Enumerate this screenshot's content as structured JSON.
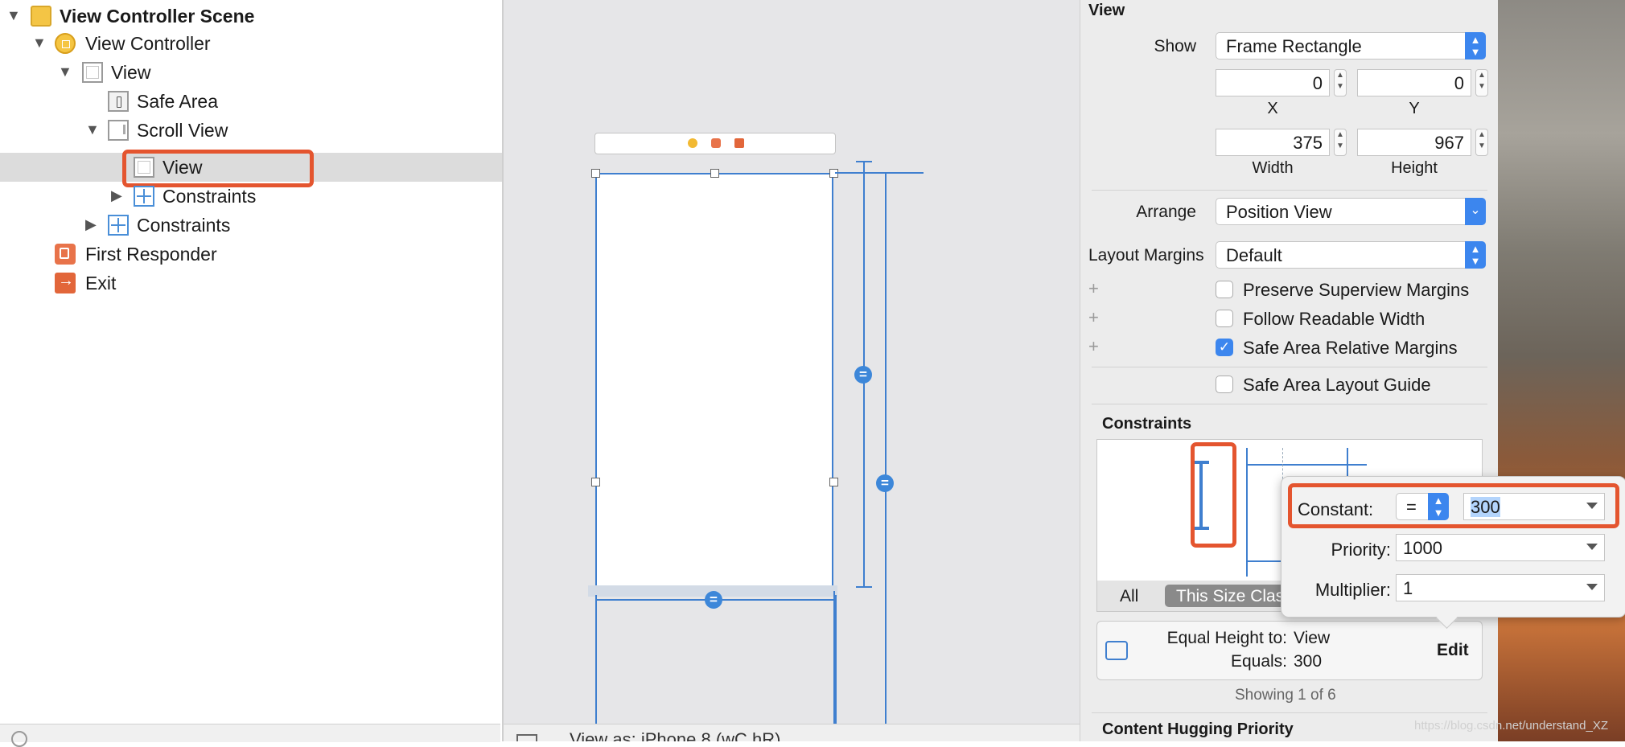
{
  "navigator": {
    "items": [
      {
        "label": "View Controller Scene",
        "icon": "storyboard-scene-icon"
      },
      {
        "label": "View Controller",
        "icon": "view-controller-icon"
      },
      {
        "label": "View",
        "icon": "view-icon"
      },
      {
        "label": "Safe Area",
        "icon": "safe-area-icon"
      },
      {
        "label": "Scroll View",
        "icon": "scroll-view-icon"
      },
      {
        "label": "View",
        "icon": "view-icon"
      },
      {
        "label": "Constraints",
        "icon": "constraints-icon"
      },
      {
        "label": "Constraints",
        "icon": "constraints-icon"
      },
      {
        "label": "First Responder",
        "icon": "first-responder-icon"
      },
      {
        "label": "Exit",
        "icon": "exit-icon"
      }
    ]
  },
  "canvas": {
    "bottom_bar_text": "View as: iPhone 8 (wC hR)"
  },
  "inspector": {
    "title": "View",
    "show_label": "Show",
    "show_value": "Frame Rectangle",
    "x_value": "0",
    "y_value": "0",
    "x_label": "X",
    "y_label": "Y",
    "width_value": "375",
    "height_value": "967",
    "width_label": "Width",
    "height_label": "Height",
    "arrange_label": "Arrange",
    "arrange_value": "Position View",
    "layout_margins_label": "Layout Margins",
    "layout_margins_value": "Default",
    "preserve_superview_margins": "Preserve Superview Margins",
    "follow_readable_width": "Follow Readable Width",
    "safe_area_relative_margins": "Safe Area Relative Margins",
    "safe_area_layout_guide": "Safe Area Layout Guide",
    "constraints_title": "Constraints",
    "tab_all": "All",
    "tab_size_class": "This Size Clas",
    "equal_height_to": "Equal Height to:",
    "equal_height_target": "View",
    "equals_label": "Equals:",
    "equals_value": "300",
    "edit_button": "Edit",
    "showing": "Showing 1 of 6",
    "content_hugging": "Content Hugging Priority"
  },
  "popover": {
    "constant_label": "Constant:",
    "relation_value": "=",
    "constant_value": "300",
    "priority_label": "Priority:",
    "priority_value": "1000",
    "multiplier_label": "Multiplier:",
    "multiplier_value": "1"
  },
  "watermark": "https://blog.csdn.net/understand_XZ",
  "colors": {
    "highlight": "#e4552f",
    "accent": "#3c86ee",
    "constraint_blue": "#3f7fcf"
  }
}
